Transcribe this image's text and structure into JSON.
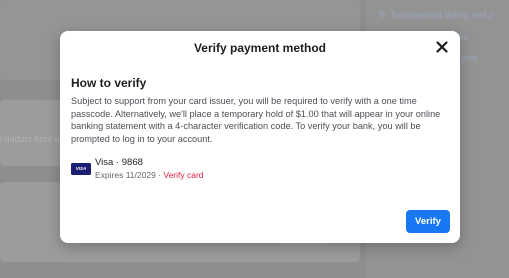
{
  "background": {
    "links": [
      "Troubleshoot Billing and p",
      "ing works",
      "your payme",
      "enter"
    ],
    "partial_text": "l daduct from a"
  },
  "modal": {
    "title": "Verify payment method",
    "section_heading": "How to verify",
    "description": "Subject to support from your card issuer, you will be required to verify with a one time passcode. Alternatively, we'll place a temporary hold of $1.00 that will appear in your online banking statement with a 4-character verification code. To verify your bank, you will be prompted to log in to your account.",
    "card": {
      "brand_logo": "VISA",
      "name": "Visa · 9868",
      "expires": "Expires 11/2029",
      "separator": " · ",
      "verify_link": "Verify card"
    },
    "verify_button": "Verify",
    "colors": {
      "primary": "#1877f2",
      "link_red": "#e41e3f",
      "visa_blue": "#1a1f71"
    }
  }
}
